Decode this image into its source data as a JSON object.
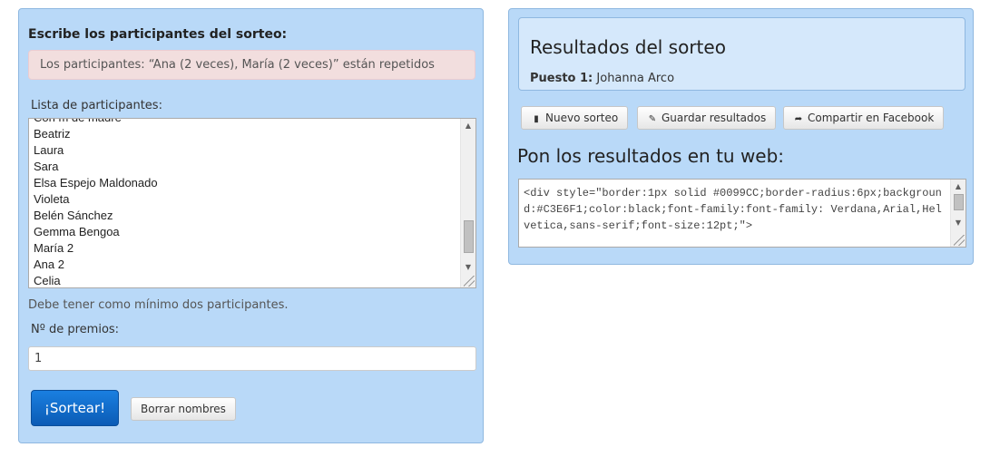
{
  "left": {
    "heading": "Escribe los participantes del sorteo:",
    "alert": "Los participantes: “Ana (2 veces), María (2 veces)” están repetidos",
    "list_label": "Lista de participantes:",
    "participants": [
      "Con m de madre",
      "Beatriz",
      "Laura",
      "Sara",
      "Elsa Espejo Maldonado",
      "Violeta",
      "Belén Sánchez",
      "Gemma Bengoa",
      "María 2",
      "Ana 2",
      "Celia"
    ],
    "scroll_up_icon": "triangle-up",
    "scroll_down_icon": "triangle-down",
    "help_text": "Debe tener como mínimo dos participantes.",
    "prizes_label": "Nº de premios:",
    "prizes_value": "1",
    "draw_button": "¡Sortear!",
    "clear_button": "Borrar nombres"
  },
  "right": {
    "results_title": "Resultados del sorteo",
    "place_label": "Puesto 1:",
    "place_winner": "Johanna Arco",
    "buttons": {
      "new_draw": "Nuevo sorteo",
      "save_results": "Guardar resultados",
      "share_facebook": "Compartir en Facebook"
    },
    "embed_heading": "Pon los resultados en tu web:",
    "embed_code": "<div style=\"border:1px solid #0099CC;border-radius:6px;background:#C3E6F1;color:black;font-family:font-family: Verdana,Arial,Helvetica,sans-serif;font-size:12pt;\">"
  },
  "colors": {
    "panel_bg": "#b9d9f8",
    "panel_border": "#8fb8e0",
    "results_box_bg": "#d5e8fb",
    "alert_bg": "#f2dede",
    "primary_button": "#0b5bb5"
  }
}
